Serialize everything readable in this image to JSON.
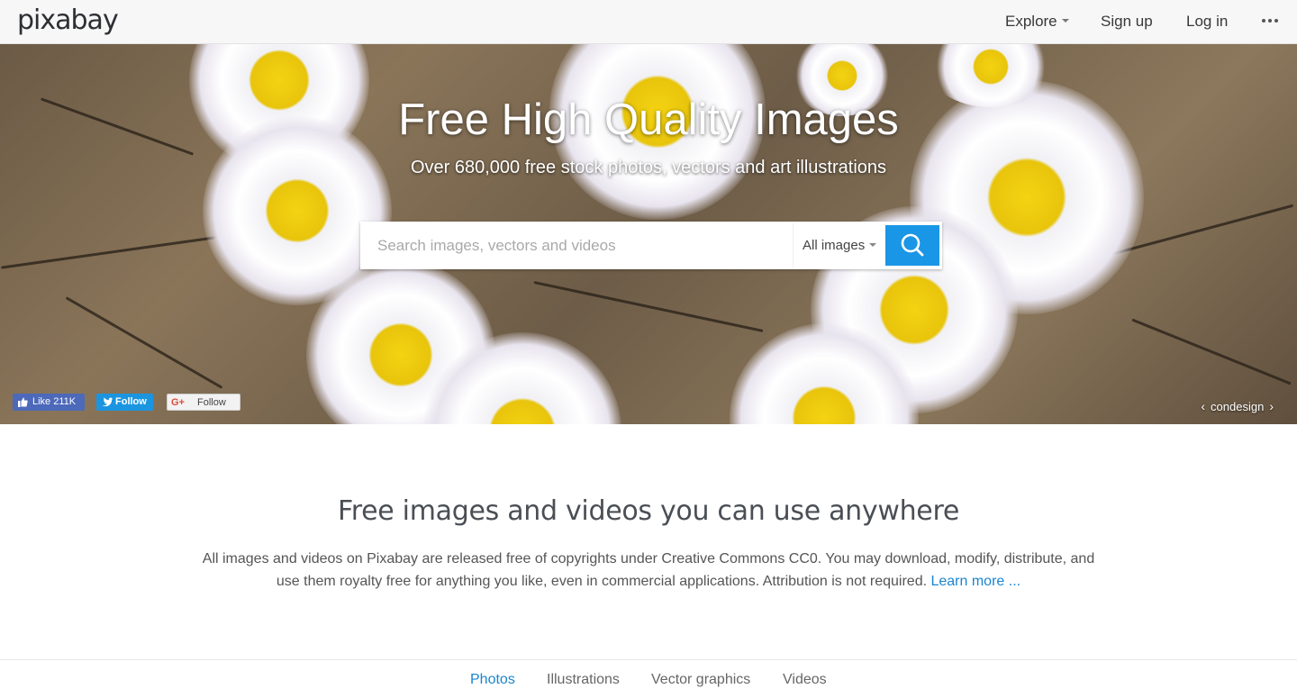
{
  "header": {
    "logo": "pixabay",
    "nav": {
      "explore": "Explore",
      "signup": "Sign up",
      "login": "Log in"
    },
    "icons": {
      "more": "more-dots-icon",
      "explore_caret": "chevron-down-icon"
    }
  },
  "hero": {
    "title": "Free High Quality Images",
    "subtitle": "Over 680,000 free stock photos, vectors and art illustrations",
    "search": {
      "placeholder": "Search images, vectors and videos",
      "value": "",
      "type_selected": "All images",
      "button_icon": "search-icon"
    },
    "social": {
      "facebook_like": "Like 211K",
      "twitter_follow": "Follow",
      "gplus_follow": "Follow"
    },
    "credit": "condesign"
  },
  "intro": {
    "title": "Free images and videos you can use anywhere",
    "text": "All images and videos on Pixabay are released free of copyrights under Creative Commons CC0. You may download, modify, distribute, and use them royalty free for anything you like, even in commercial applications. Attribution is not required.",
    "learn_more": "Learn more ..."
  },
  "tabs": [
    {
      "label": "Photos",
      "active": true
    },
    {
      "label": "Illustrations",
      "active": false
    },
    {
      "label": "Vector graphics",
      "active": false
    },
    {
      "label": "Videos",
      "active": false
    }
  ],
  "colors": {
    "accent": "#1a96e6",
    "link": "#1a85d0",
    "facebook": "#4c69ba",
    "twitter": "#1b95e0"
  }
}
